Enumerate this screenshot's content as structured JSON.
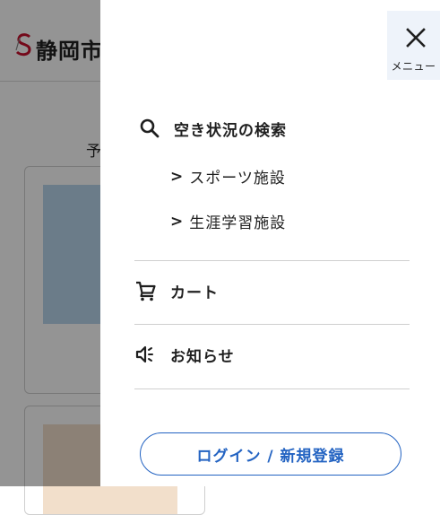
{
  "background": {
    "logo_text": "静岡市",
    "heading": "予"
  },
  "drawer": {
    "close_label": "メニュー",
    "search_title": "空き状況の検索",
    "sub_items": [
      {
        "chevron": ">",
        "label": "スポーツ施設"
      },
      {
        "chevron": ">",
        "label": "生涯学習施設"
      }
    ],
    "cart_label": "カート",
    "news_label": "お知らせ",
    "login_label": "ログイン / 新規登録"
  },
  "icons": {
    "close": "close-icon",
    "search": "search-icon",
    "cart": "cart-icon",
    "news": "megaphone-icon"
  },
  "colors": {
    "accent": "#2363c2",
    "close_bg": "#eef3fa",
    "overlay": "rgba(0,0,0,0.42)"
  }
}
